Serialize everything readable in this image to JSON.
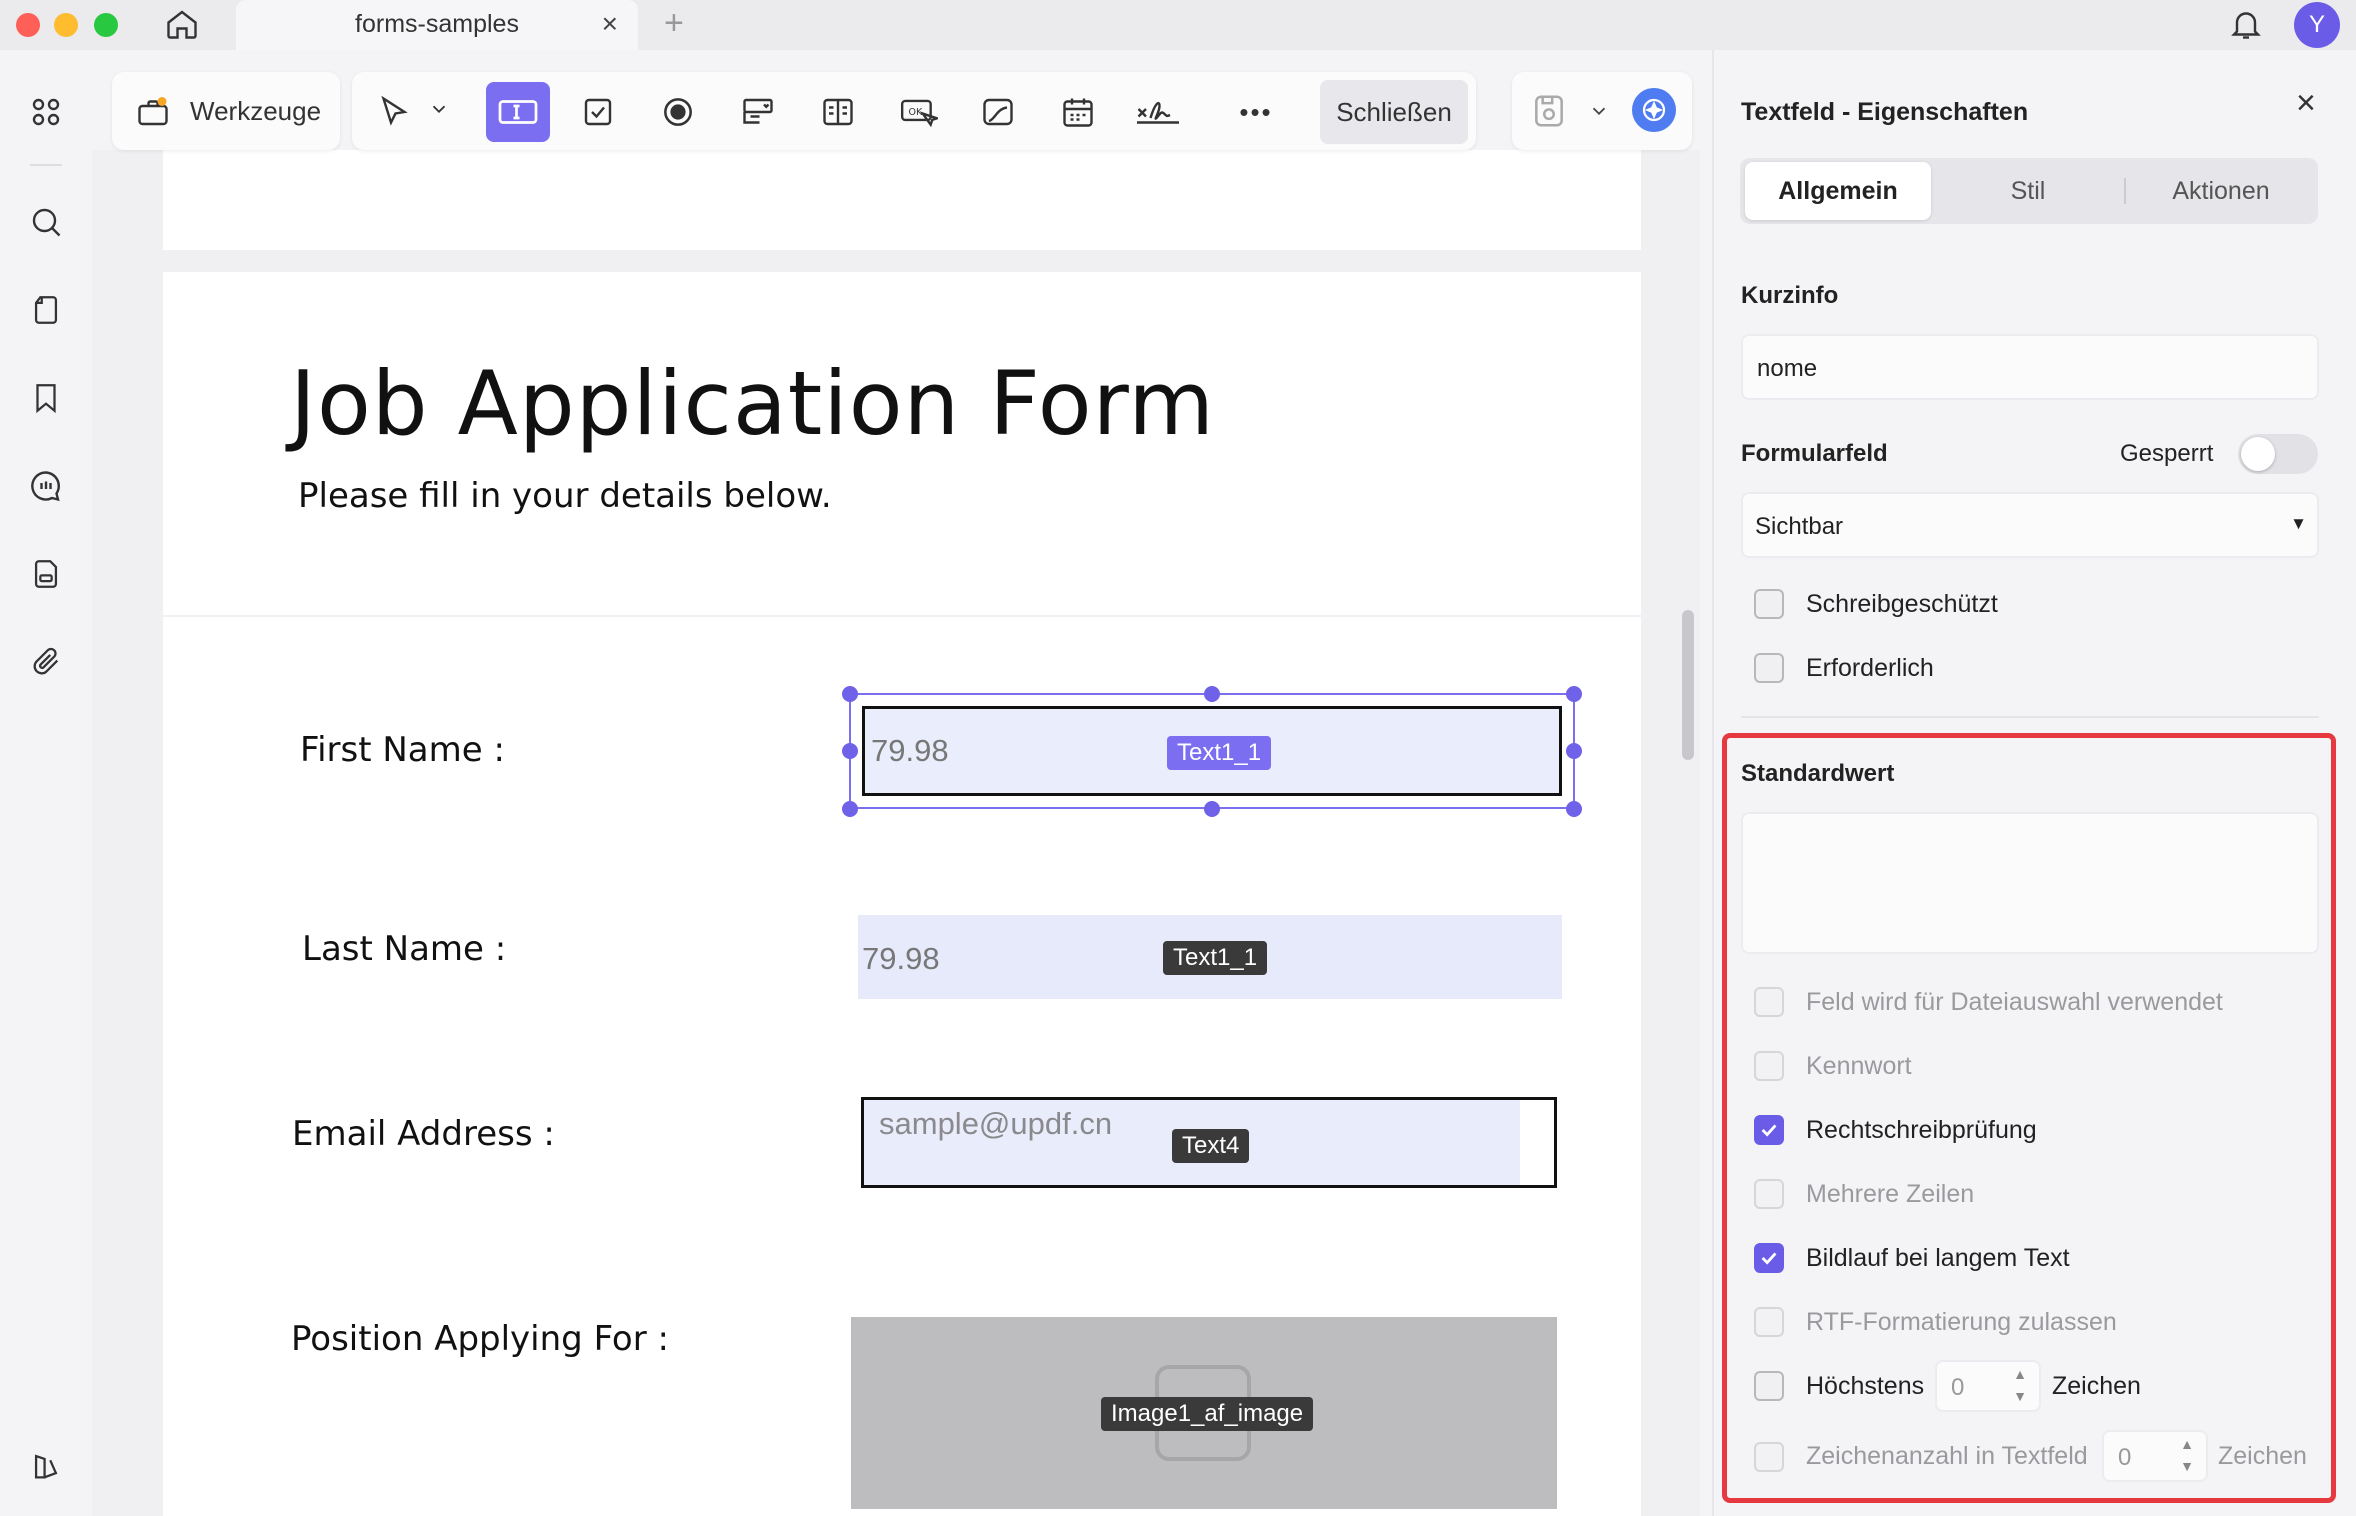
{
  "titlebar": {
    "tab_title": "forms-samples",
    "tab_close": "×",
    "new_tab": "+",
    "avatar_initial": "Y",
    "traffic_colors": [
      "#fe5f57",
      "#febc2e",
      "#28c840"
    ]
  },
  "toolbar": {
    "tools_label": "Werkzeuge",
    "more_label": "•••",
    "close_label": "Schließen",
    "accent_color": "#7b6ef0"
  },
  "document": {
    "title": "Job Application Form",
    "subtitle": "Please fill in your details below.",
    "fields": [
      {
        "label": "First Name :",
        "value": "79.98",
        "tag": "Text1_1"
      },
      {
        "label": "Last Name :",
        "value": "79.98",
        "tag": "Text1_1"
      },
      {
        "label": "Email Address :",
        "value": "sample@updf.cn",
        "tag": "Text4"
      },
      {
        "label": "Position Applying For :",
        "value": "",
        "tag": "Image1_af_image"
      }
    ]
  },
  "panel": {
    "title": "Textfeld - Eigenschaften",
    "close": "×",
    "tabs": [
      "Allgemein",
      "Stil",
      "Aktionen"
    ],
    "active_tab": "Allgemein",
    "kurzinfo_label": "Kurzinfo",
    "kurzinfo_value": "nome",
    "formularfeld_label": "Formularfeld",
    "gesperrt_label": "Gesperrt",
    "visibility_value": "Sichtbar",
    "visibility_arrow": "▼",
    "checks_top": [
      {
        "label": "Schreibgeschützt",
        "checked": false
      },
      {
        "label": "Erforderlich",
        "checked": false
      }
    ],
    "standardwert_label": "Standardwert",
    "standardwert_value": "",
    "checks_bottom": [
      {
        "label": "Feld wird für Dateiauswahl verwendet",
        "checked": false,
        "disabled": true
      },
      {
        "label": "Kennwort",
        "checked": false,
        "disabled": true
      },
      {
        "label": "Rechtschreibprüfung",
        "checked": true,
        "disabled": false
      },
      {
        "label": "Mehrere Zeilen",
        "checked": false,
        "disabled": true
      },
      {
        "label": "Bildlauf bei langem Text",
        "checked": true,
        "disabled": false
      },
      {
        "label": "RTF-Formatierung zulassen",
        "checked": false,
        "disabled": true
      }
    ],
    "max_label": "Höchstens",
    "max_value": "0",
    "max_unit": "Zeichen",
    "count_label": "Zeichenanzahl in Textfeld",
    "count_value": "0",
    "count_unit": "Zeichen",
    "highlight_color": "#e5393f"
  }
}
